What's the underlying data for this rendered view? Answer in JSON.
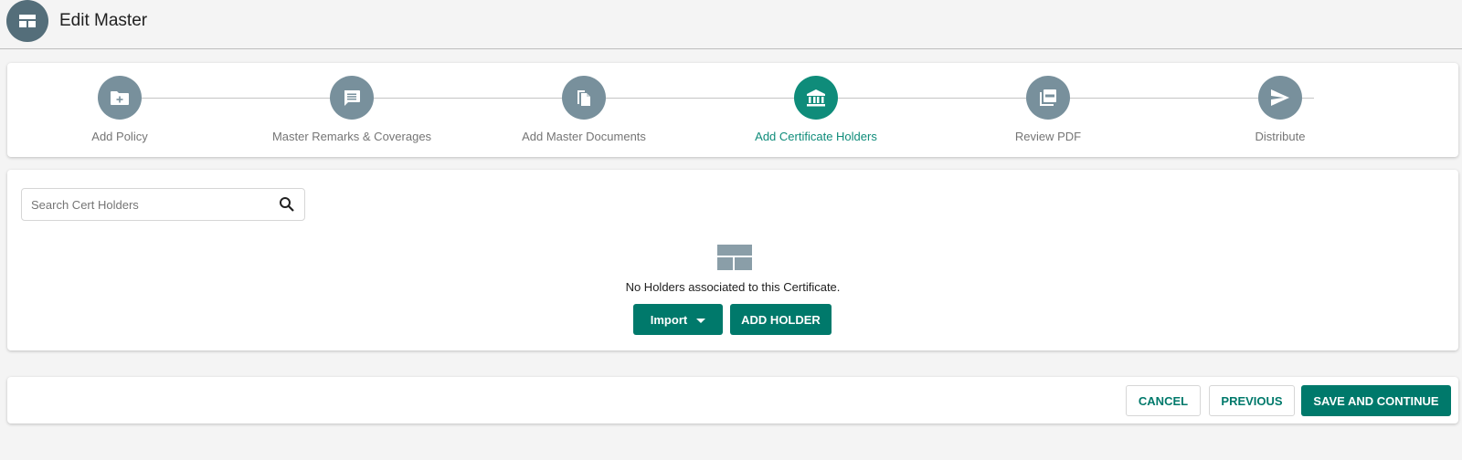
{
  "header": {
    "title": "Edit Master",
    "icon": "table-layout-icon"
  },
  "stepper": {
    "active_color": "#0f8c7a",
    "inactive_color": "#78909c",
    "steps": [
      {
        "label": "Add Policy",
        "icon": "folder-plus-icon",
        "active": false
      },
      {
        "label": "Master Remarks & Coverages",
        "icon": "comment-icon",
        "active": false
      },
      {
        "label": "Add Master Documents",
        "icon": "documents-icon",
        "active": false
      },
      {
        "label": "Add Certificate Holders",
        "icon": "bank-icon",
        "active": true
      },
      {
        "label": "Review PDF",
        "icon": "pdf-icon",
        "active": false
      },
      {
        "label": "Distribute",
        "icon": "send-icon",
        "active": false
      }
    ]
  },
  "main": {
    "search": {
      "placeholder": "Search Cert Holders",
      "value": ""
    },
    "empty_message": "No Holders associated to this Certificate.",
    "import_label": "Import",
    "add_holder_label": "ADD HOLDER"
  },
  "footer": {
    "cancel_label": "CANCEL",
    "previous_label": "PREVIOUS",
    "save_label": "SAVE AND CONTINUE"
  },
  "colors": {
    "primary": "#00796b",
    "header_icon_bg": "#546e7a"
  }
}
